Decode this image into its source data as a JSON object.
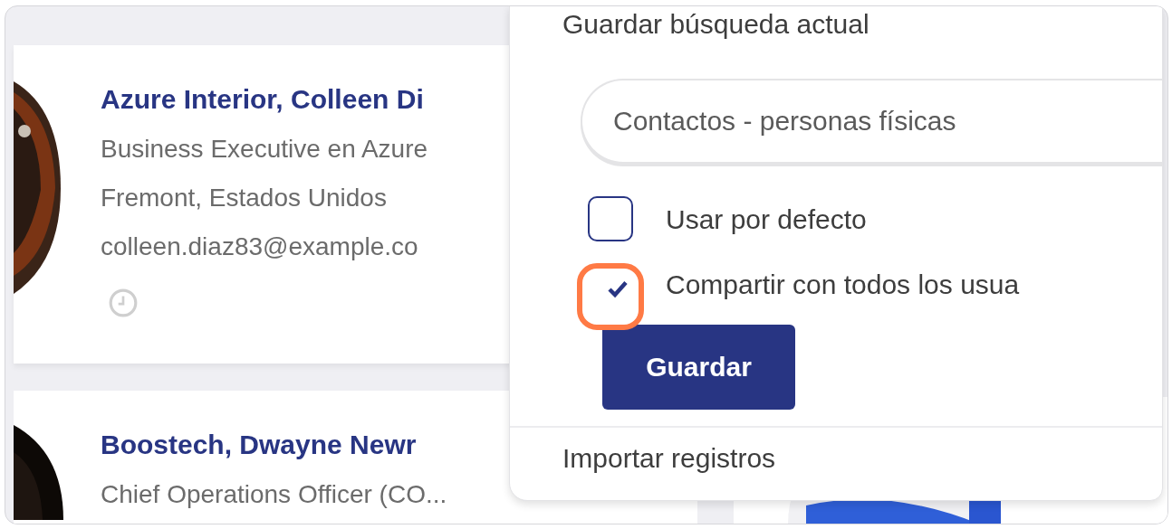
{
  "contacts": [
    {
      "name": "Azure Interior, Colleen Di",
      "lines": [
        "Business Executive en Azure",
        "Fremont, Estados Unidos",
        "colleen.diaz83@example.co"
      ],
      "activity_icon": true
    },
    {
      "name": "Boostech, Dwayne Newr",
      "lines": [
        "Chief Operations Officer (CO..."
      ]
    }
  ],
  "dropdown": {
    "section_title": "Guardar búsqueda actual",
    "name_field": {
      "value": "Contactos - personas físicas"
    },
    "options": [
      {
        "label": "Usar por defecto",
        "checked": false,
        "highlighted": false
      },
      {
        "label": "Compartir con todos los usua",
        "checked": true,
        "highlighted": true
      }
    ],
    "save_button": "Guardar",
    "import_item": "Importar registros"
  }
}
